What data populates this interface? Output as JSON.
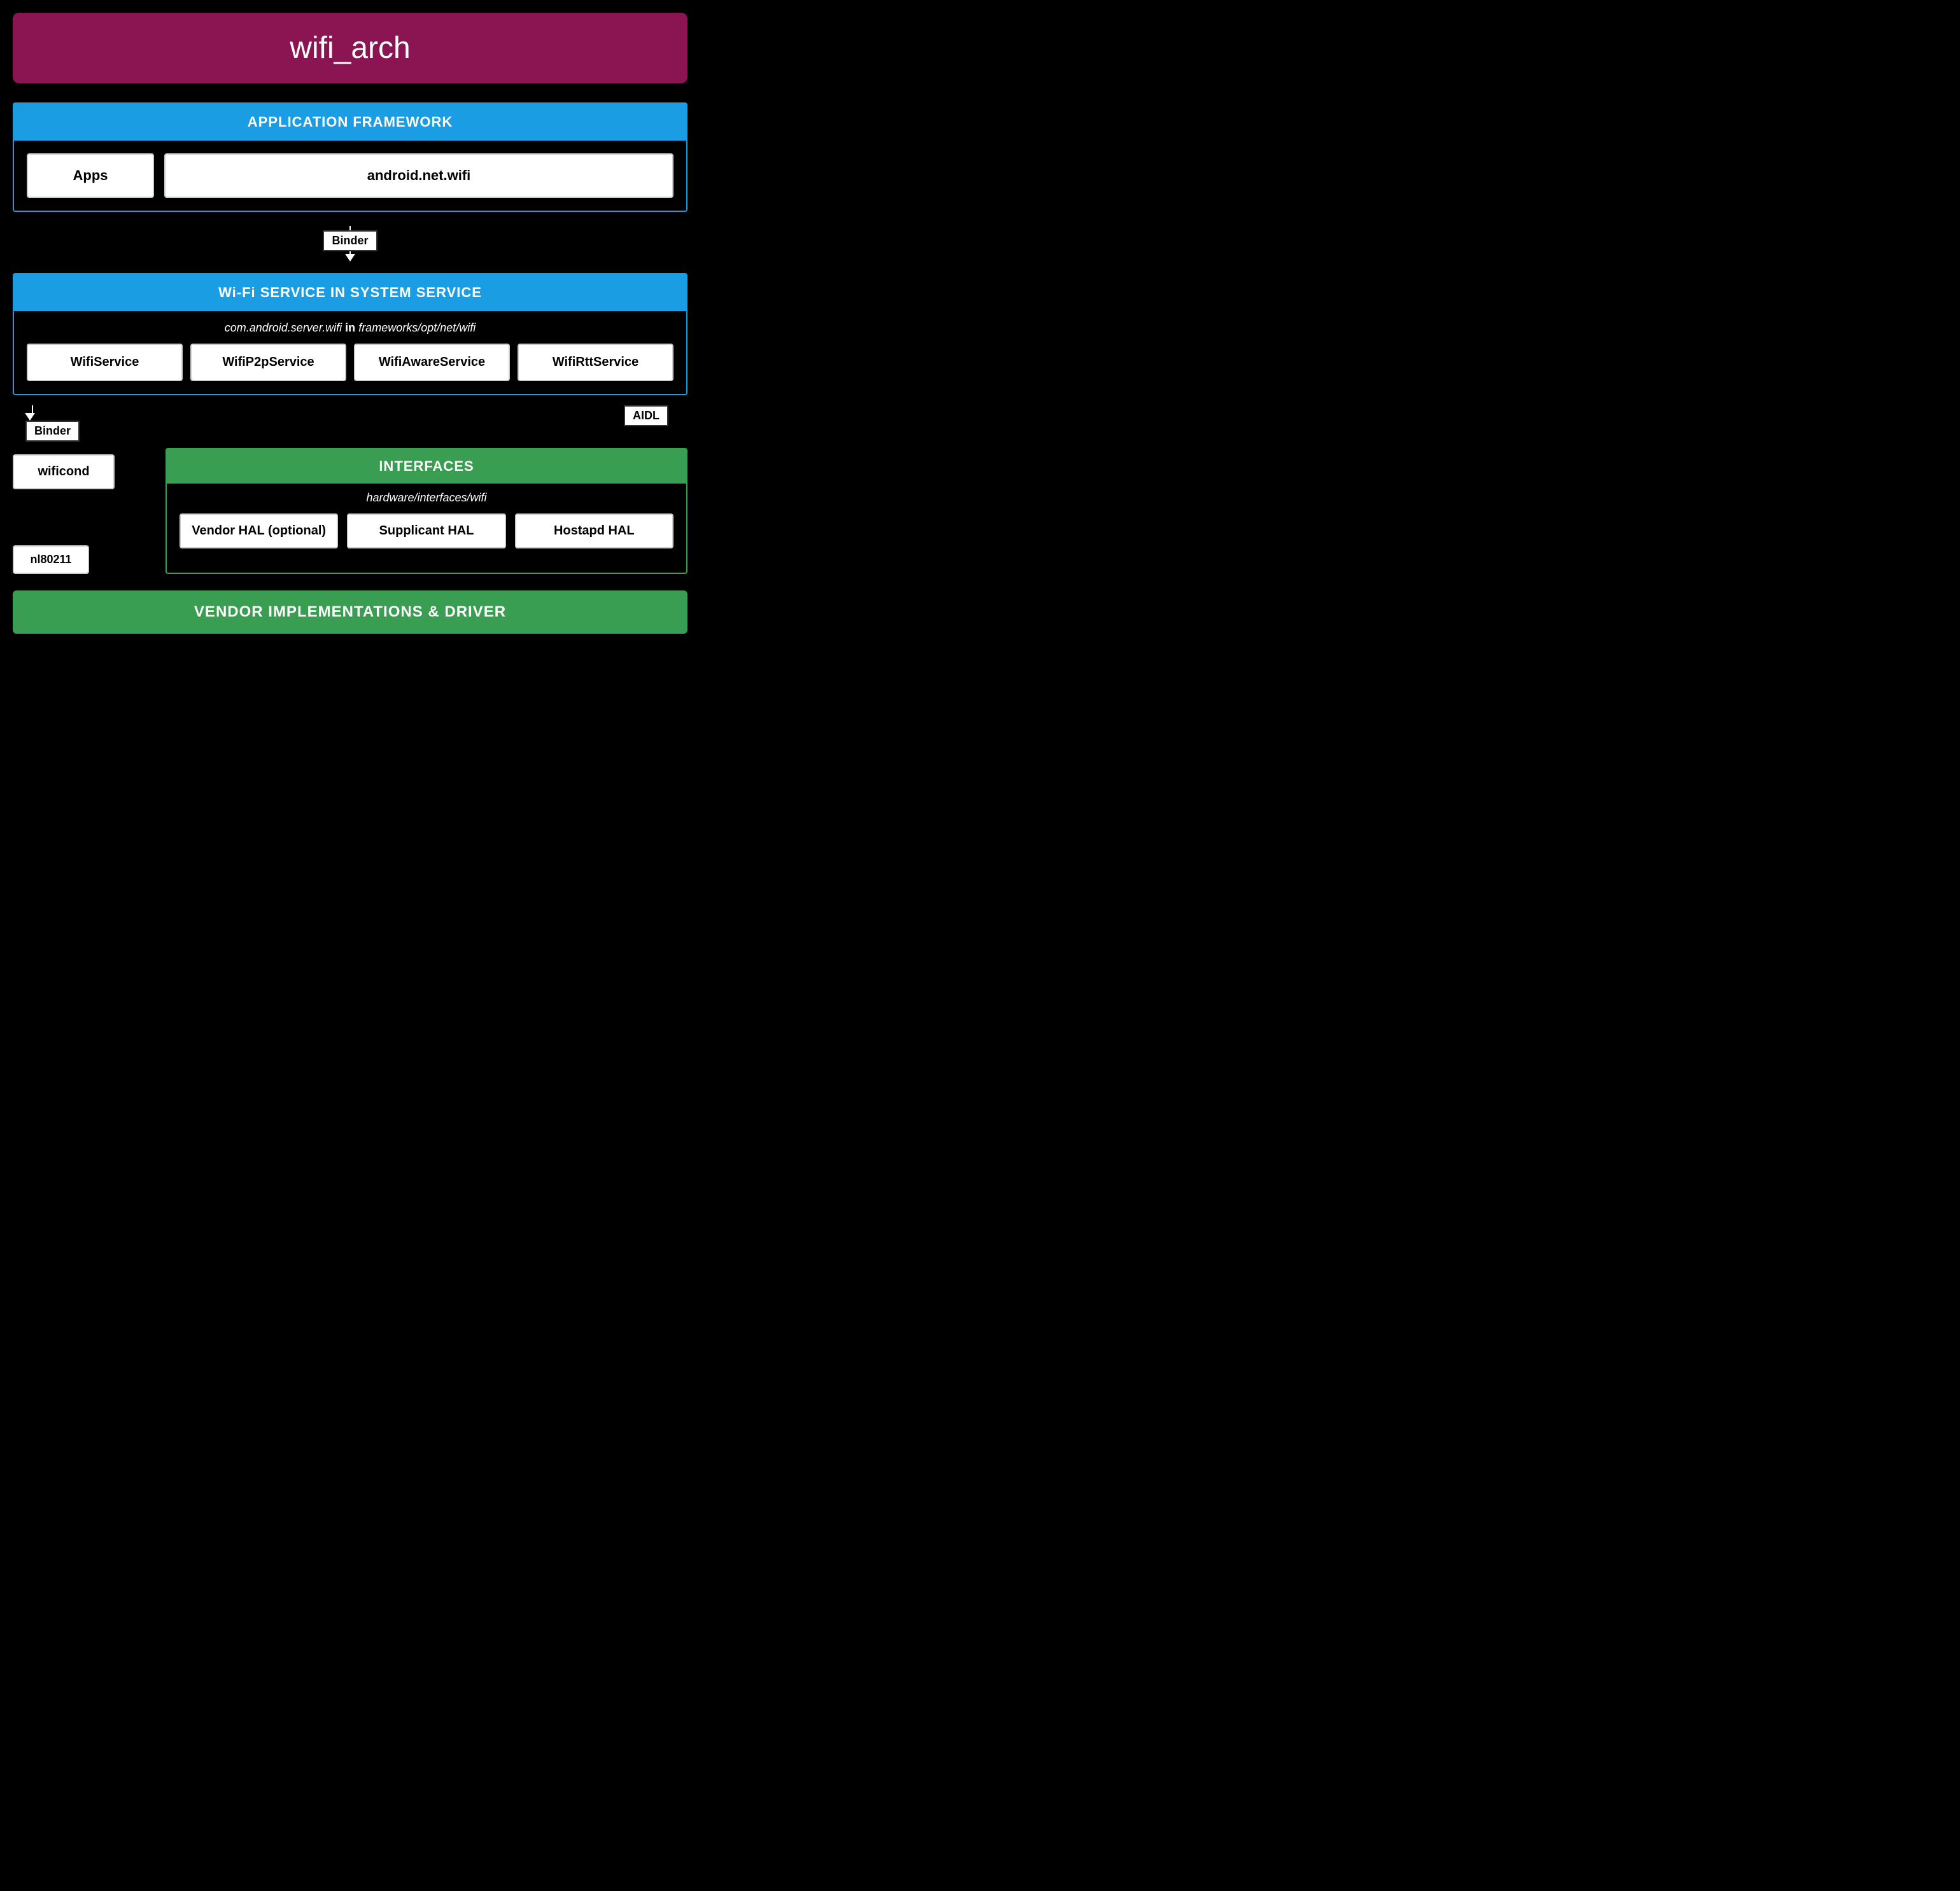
{
  "title": "wifi_arch",
  "titleBg": "#8B1552",
  "sections": {
    "appFramework": {
      "header": "APPLICATION FRAMEWORK",
      "apps": "Apps",
      "androidNetWifi": "android.net.wifi"
    },
    "binder1": "Binder",
    "wifiService": {
      "header": "Wi-Fi SERVICE IN SYSTEM SERVICE",
      "subLabel": "com.android.server.wifi",
      "subLabelBold": "in",
      "subLabelPath": "frameworks/opt/net/wifi",
      "services": [
        "WifiService",
        "WifiP2pService",
        "WifiAwareService",
        "WifiRttService"
      ]
    },
    "binder2": "Binder",
    "aidl": "AIDL",
    "wificond": "wificond",
    "nl80211": "nl80211",
    "interfaces": {
      "header": "INTERFACES",
      "subLabel": "hardware/interfaces/wifi",
      "hal": [
        "Vendor HAL (optional)",
        "Supplicant HAL",
        "Hostapd HAL"
      ]
    },
    "vendorBar": "VENDOR IMPLEMENTATIONS & DRIVER"
  },
  "colors": {
    "blue": "#1a9de3",
    "green": "#3a9e52",
    "maroon": "#8B1552",
    "white": "#ffffff",
    "black": "#000000"
  }
}
